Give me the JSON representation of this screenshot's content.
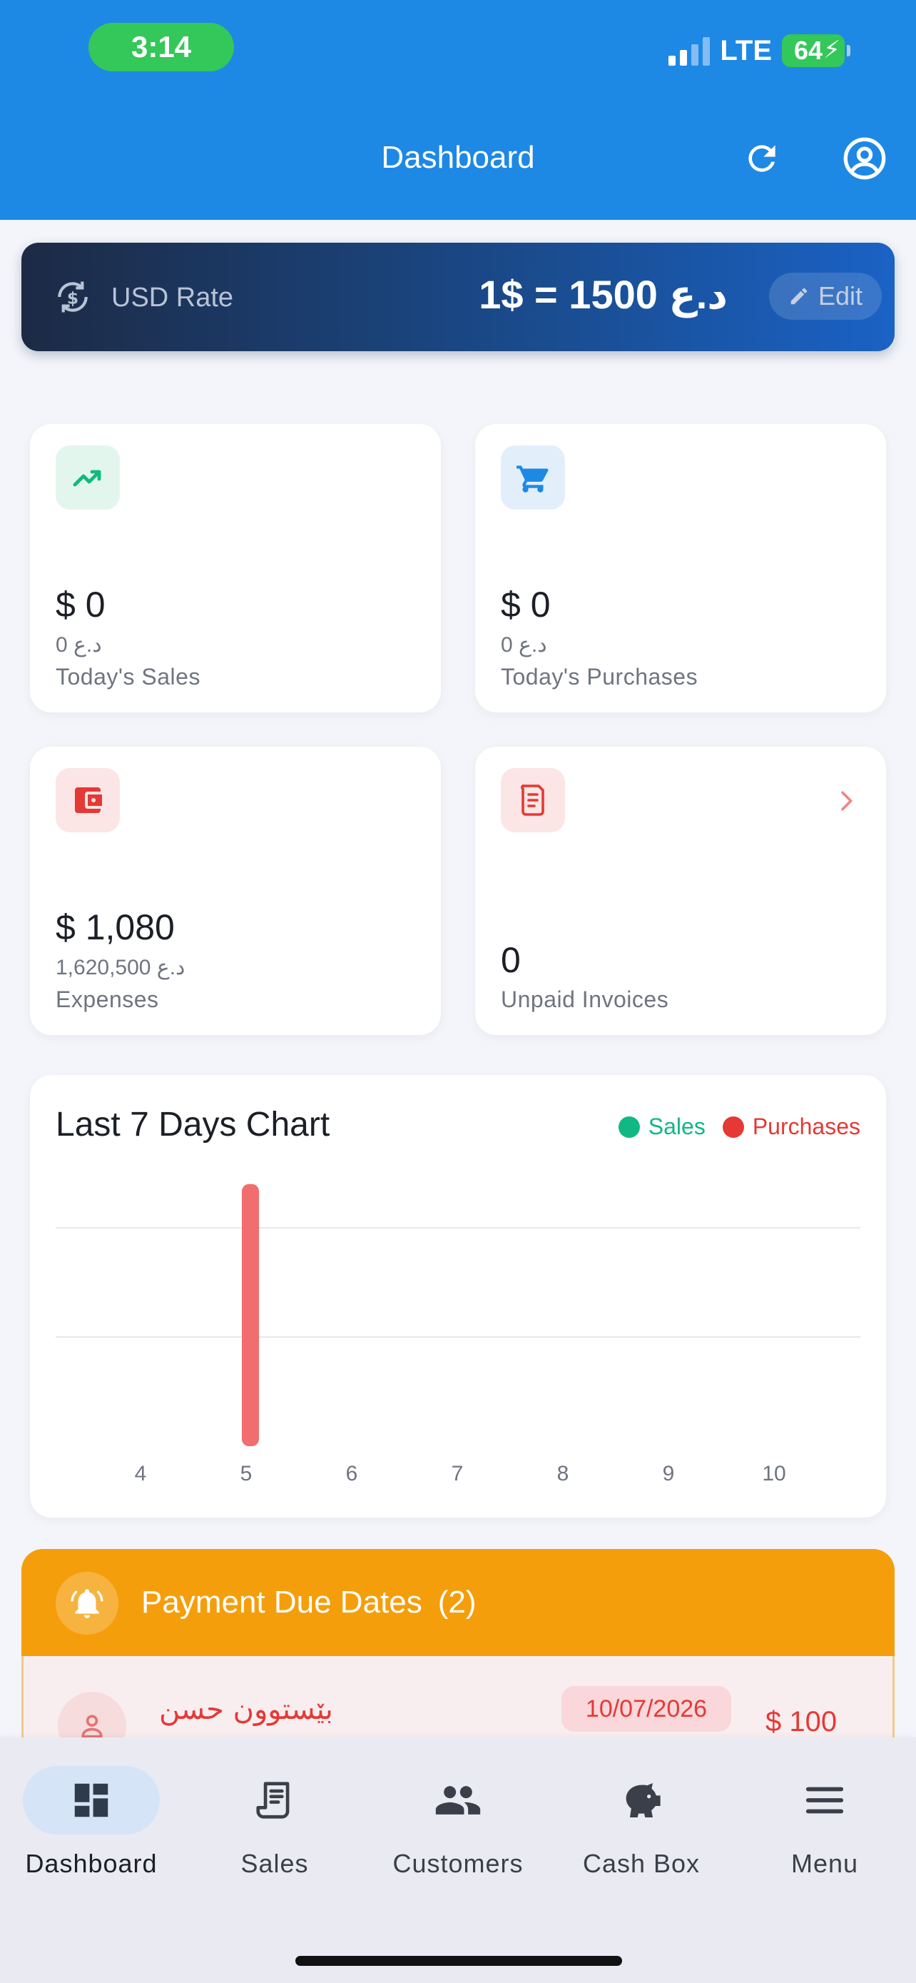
{
  "status_bar": {
    "time": "3:14",
    "network": "LTE",
    "battery": "64"
  },
  "header": {
    "title": "Dashboard",
    "refresh_icon": "refresh-icon",
    "account_icon": "account-circle-icon"
  },
  "usd_rate": {
    "label": "USD Rate",
    "value": "1$ = 1500 د.ع",
    "edit_label": "Edit"
  },
  "stats": [
    {
      "usd": "$ 0",
      "iqd": "0 د.ع",
      "label": "Today's Sales",
      "icon": "trending-up-icon",
      "accent": "#10b981",
      "icon_bg": "#e3f6ee"
    },
    {
      "usd": "$ 0",
      "iqd": "0 د.ع",
      "label": "Today's Purchases",
      "icon": "cart-icon",
      "accent": "#1e88e5",
      "icon_bg": "#e2effb"
    },
    {
      "usd": "$ 1,080",
      "iqd": "1,620,500 د.ع",
      "label": "Expenses",
      "icon": "wallet-icon",
      "accent": "#e53935",
      "icon_bg": "#fbe5e5"
    },
    {
      "value": "0",
      "label": "Unpaid Invoices",
      "icon": "receipt-icon",
      "accent": "#e53935",
      "icon_bg": "#fbe5e5"
    }
  ],
  "chart_data": {
    "type": "bar",
    "title": "Last 7 Days Chart",
    "categories": [
      "4",
      "5",
      "6",
      "7",
      "8",
      "9",
      "10"
    ],
    "series": [
      {
        "name": "Sales",
        "color": "#10b981",
        "values": [
          0,
          0,
          0,
          0,
          0,
          0,
          0
        ]
      },
      {
        "name": "Purchases",
        "color": "#f26d6d",
        "values": [
          0,
          1.2,
          0,
          0,
          0,
          0,
          0
        ]
      }
    ],
    "ylim": [
      0,
      1
    ],
    "grid": true,
    "legend": "top-right"
  },
  "payment_due": {
    "title": "Payment Due Dates",
    "count": "(2)",
    "items": [
      {
        "name": "بێستوون حسن",
        "date": "10/07/2026",
        "amount": "$ 100"
      }
    ]
  },
  "tabs": [
    {
      "label": "Dashboard",
      "icon": "dashboard-icon",
      "active": true
    },
    {
      "label": "Sales",
      "icon": "receipt-icon",
      "active": false
    },
    {
      "label": "Customers",
      "icon": "people-icon",
      "active": false
    },
    {
      "label": "Cash Box",
      "icon": "piggy-bank-icon",
      "active": false
    },
    {
      "label": "Menu",
      "icon": "menu-icon",
      "active": false
    }
  ]
}
